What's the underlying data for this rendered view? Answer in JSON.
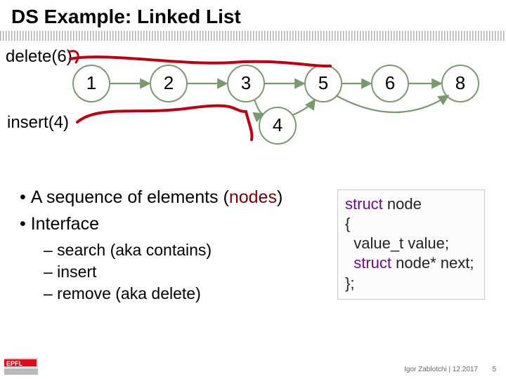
{
  "title": "DS Example: Linked List",
  "ops": {
    "delete_label": "delete(6)",
    "insert_label": "insert(4)"
  },
  "nodes": {
    "main": [
      1,
      2,
      3,
      5,
      6,
      8
    ],
    "inserted": 4
  },
  "body": {
    "b1_pre": "A sequence of elements (",
    "b1_nodes": "nodes",
    "b1_post": ")",
    "b2": "Interface",
    "s1": "– search (aka contains)",
    "s2": "– insert",
    "s3": "– remove (aka delete)"
  },
  "code": {
    "l1_kw": "struct",
    "l1_rest": " node",
    "l2": "{",
    "l3": "  value_t value;",
    "l4_pre": "  ",
    "l4_kw": "struct",
    "l4_rest": " node* next;",
    "l5": "};"
  },
  "footer": "Igor Zablotchi | 12.2017",
  "page": "5",
  "chart_data": {
    "type": "diagram",
    "structure": "singly-linked-list",
    "nodes_main": [
      1,
      2,
      3,
      5,
      6,
      8
    ],
    "links": [
      [
        1,
        2
      ],
      [
        2,
        3
      ],
      [
        3,
        5
      ],
      [
        5,
        6
      ],
      [
        6,
        8
      ]
    ],
    "insert_op": {
      "value": 4,
      "between": [
        3,
        5
      ]
    },
    "delete_op": {
      "value": 6,
      "bypass": [
        5,
        8
      ]
    },
    "annotations": [
      "delete(6)",
      "insert(4)"
    ]
  }
}
